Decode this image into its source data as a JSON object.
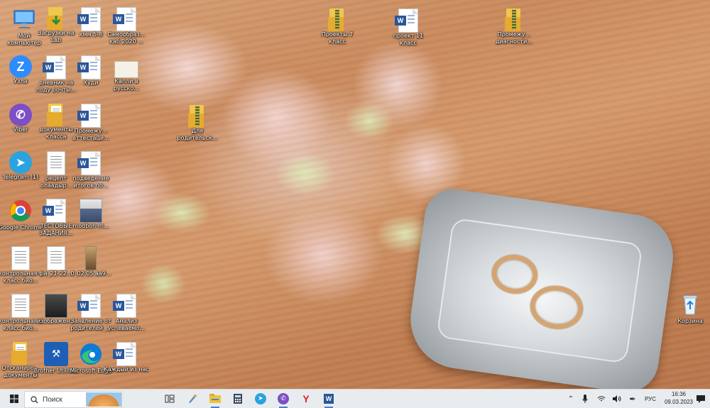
{
  "desktop": {
    "icons": [
      {
        "label": "Мой компьютер",
        "kind": "computer"
      },
      {
        "label": "Загрузки на Lab",
        "kind": "folder-download"
      },
      {
        "label": "кмм 5-8",
        "kind": "word"
      },
      {
        "label": "Самообраз... каб 2020 ...",
        "kind": "word"
      },
      {
        "label": "Проекты 7 класс",
        "kind": "zip"
      },
      {
        "label": "проект 11 класс",
        "kind": "word"
      },
      {
        "label": "Промежу... диагности...",
        "kind": "zip"
      },
      {
        "label": "Узла",
        "kind": "app-zoom"
      },
      {
        "label": "дневник на поду рочты...",
        "kind": "word"
      },
      {
        "label": "Худи",
        "kind": "word"
      },
      {
        "label": "Капли в русско...",
        "kind": "image"
      },
      {
        "label": "Viber",
        "kind": "app-viber"
      },
      {
        "label": "документы класса",
        "kind": "folder"
      },
      {
        "label": "Промежу... аттестаци...",
        "kind": "word"
      },
      {
        "label": "Для родительск...",
        "kind": "zip"
      },
      {
        "label": "Telegram (1)",
        "kind": "app-telegram"
      },
      {
        "label": "рецепт олаадыр...",
        "kind": "text"
      },
      {
        "label": "подведение итогов по...",
        "kind": "word"
      },
      {
        "label": "Google Chrome",
        "kind": "app-chrome"
      },
      {
        "label": "ТЕСТОВЫЕ ЗАДАНИЯ...",
        "kind": "word"
      },
      {
        "label": "modbon-m...",
        "kind": "photo"
      },
      {
        "label": "контрольная 6 класс био...",
        "kind": "image"
      },
      {
        "label": "ра_21-22...",
        "kind": "image"
      },
      {
        "label": "0_02.05 аа9...",
        "kind": "photo"
      },
      {
        "label": "контрольная 6 класс био...",
        "kind": "image"
      },
      {
        "label": "изображен...",
        "kind": "photo"
      },
      {
        "label": "Заявление от родителей_...",
        "kind": "word"
      },
      {
        "label": "Анализ успеваемо...",
        "kind": "word"
      },
      {
        "label": "Отсканиро... документы",
        "kind": "folder"
      },
      {
        "label": "Brother Utilities",
        "kind": "app-brother"
      },
      {
        "label": "Microsoft Edge",
        "kind": "app-edge"
      },
      {
        "label": "Каждый из нас",
        "kind": "word"
      },
      {
        "label": "Корзина",
        "kind": "recycle"
      }
    ]
  },
  "taskbar": {
    "search_placeholder": "Поиск",
    "language": "РУС",
    "time": "16:36",
    "date": "09.03.2023"
  },
  "colors": {
    "word_blue": "#2b579a",
    "taskbar_bg": "#e8ecef",
    "folder_yellow": "#f1c64c"
  }
}
